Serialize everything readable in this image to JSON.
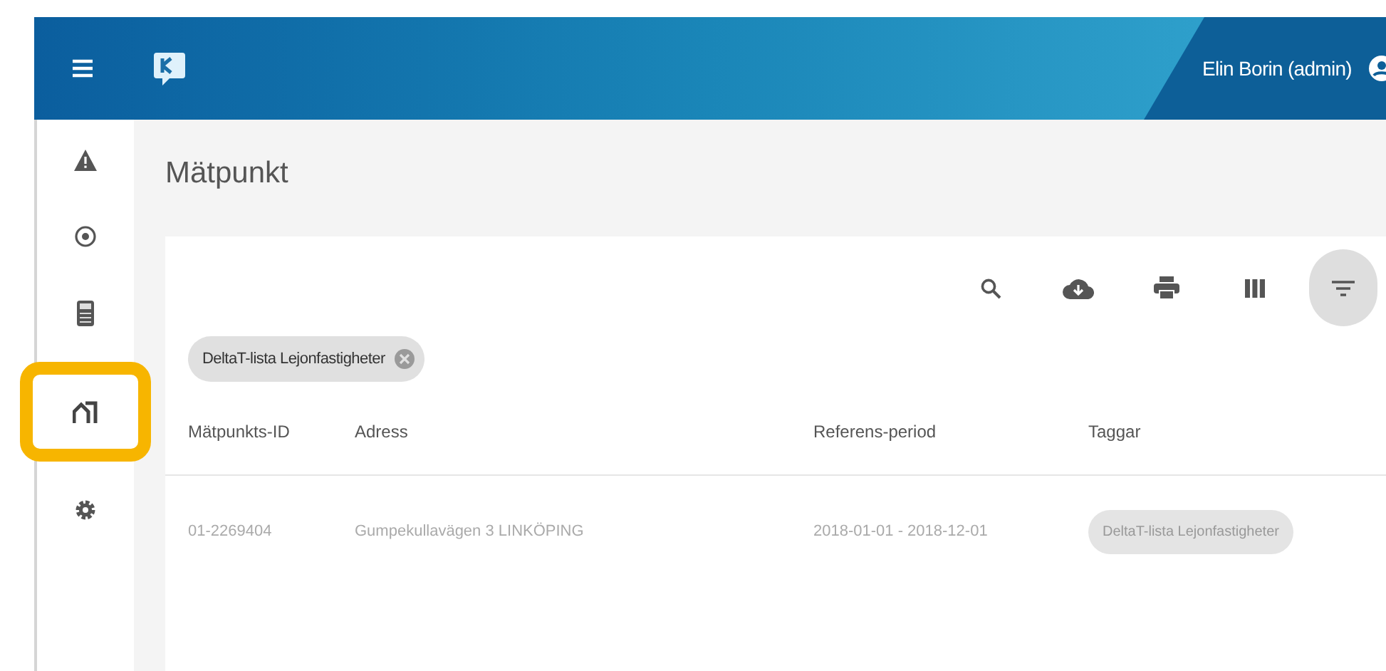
{
  "header": {
    "user": "Elin Borin (admin)"
  },
  "sidebar": {
    "items": [
      {
        "kind": "warning",
        "highlighted": false
      },
      {
        "kind": "target",
        "highlighted": false
      },
      {
        "kind": "meter",
        "highlighted": false
      },
      {
        "kind": "building",
        "highlighted": true
      },
      {
        "kind": "settings",
        "highlighted": false
      }
    ]
  },
  "page": {
    "title": "Mätpunkt"
  },
  "toolbar": {
    "buttons": [
      {
        "kind": "search",
        "selected": false
      },
      {
        "kind": "download",
        "selected": false
      },
      {
        "kind": "print",
        "selected": false
      },
      {
        "kind": "columns",
        "selected": false
      },
      {
        "kind": "filter",
        "selected": true
      }
    ]
  },
  "filter_chips": [
    {
      "label": "DeltaT-lista Lejonfastigheter"
    }
  ],
  "table": {
    "columns": [
      "Mätpunkts-ID",
      "Adress",
      "Referens-period",
      "Taggar"
    ],
    "rows": [
      {
        "cells": [
          "01-2269404",
          "Gumpekullavägen 3 LINKÖPING",
          "2018-01-01 - 2018-12-01"
        ],
        "tags": [
          "DeltaT-lista Lejonfastigheter"
        ]
      }
    ]
  }
}
